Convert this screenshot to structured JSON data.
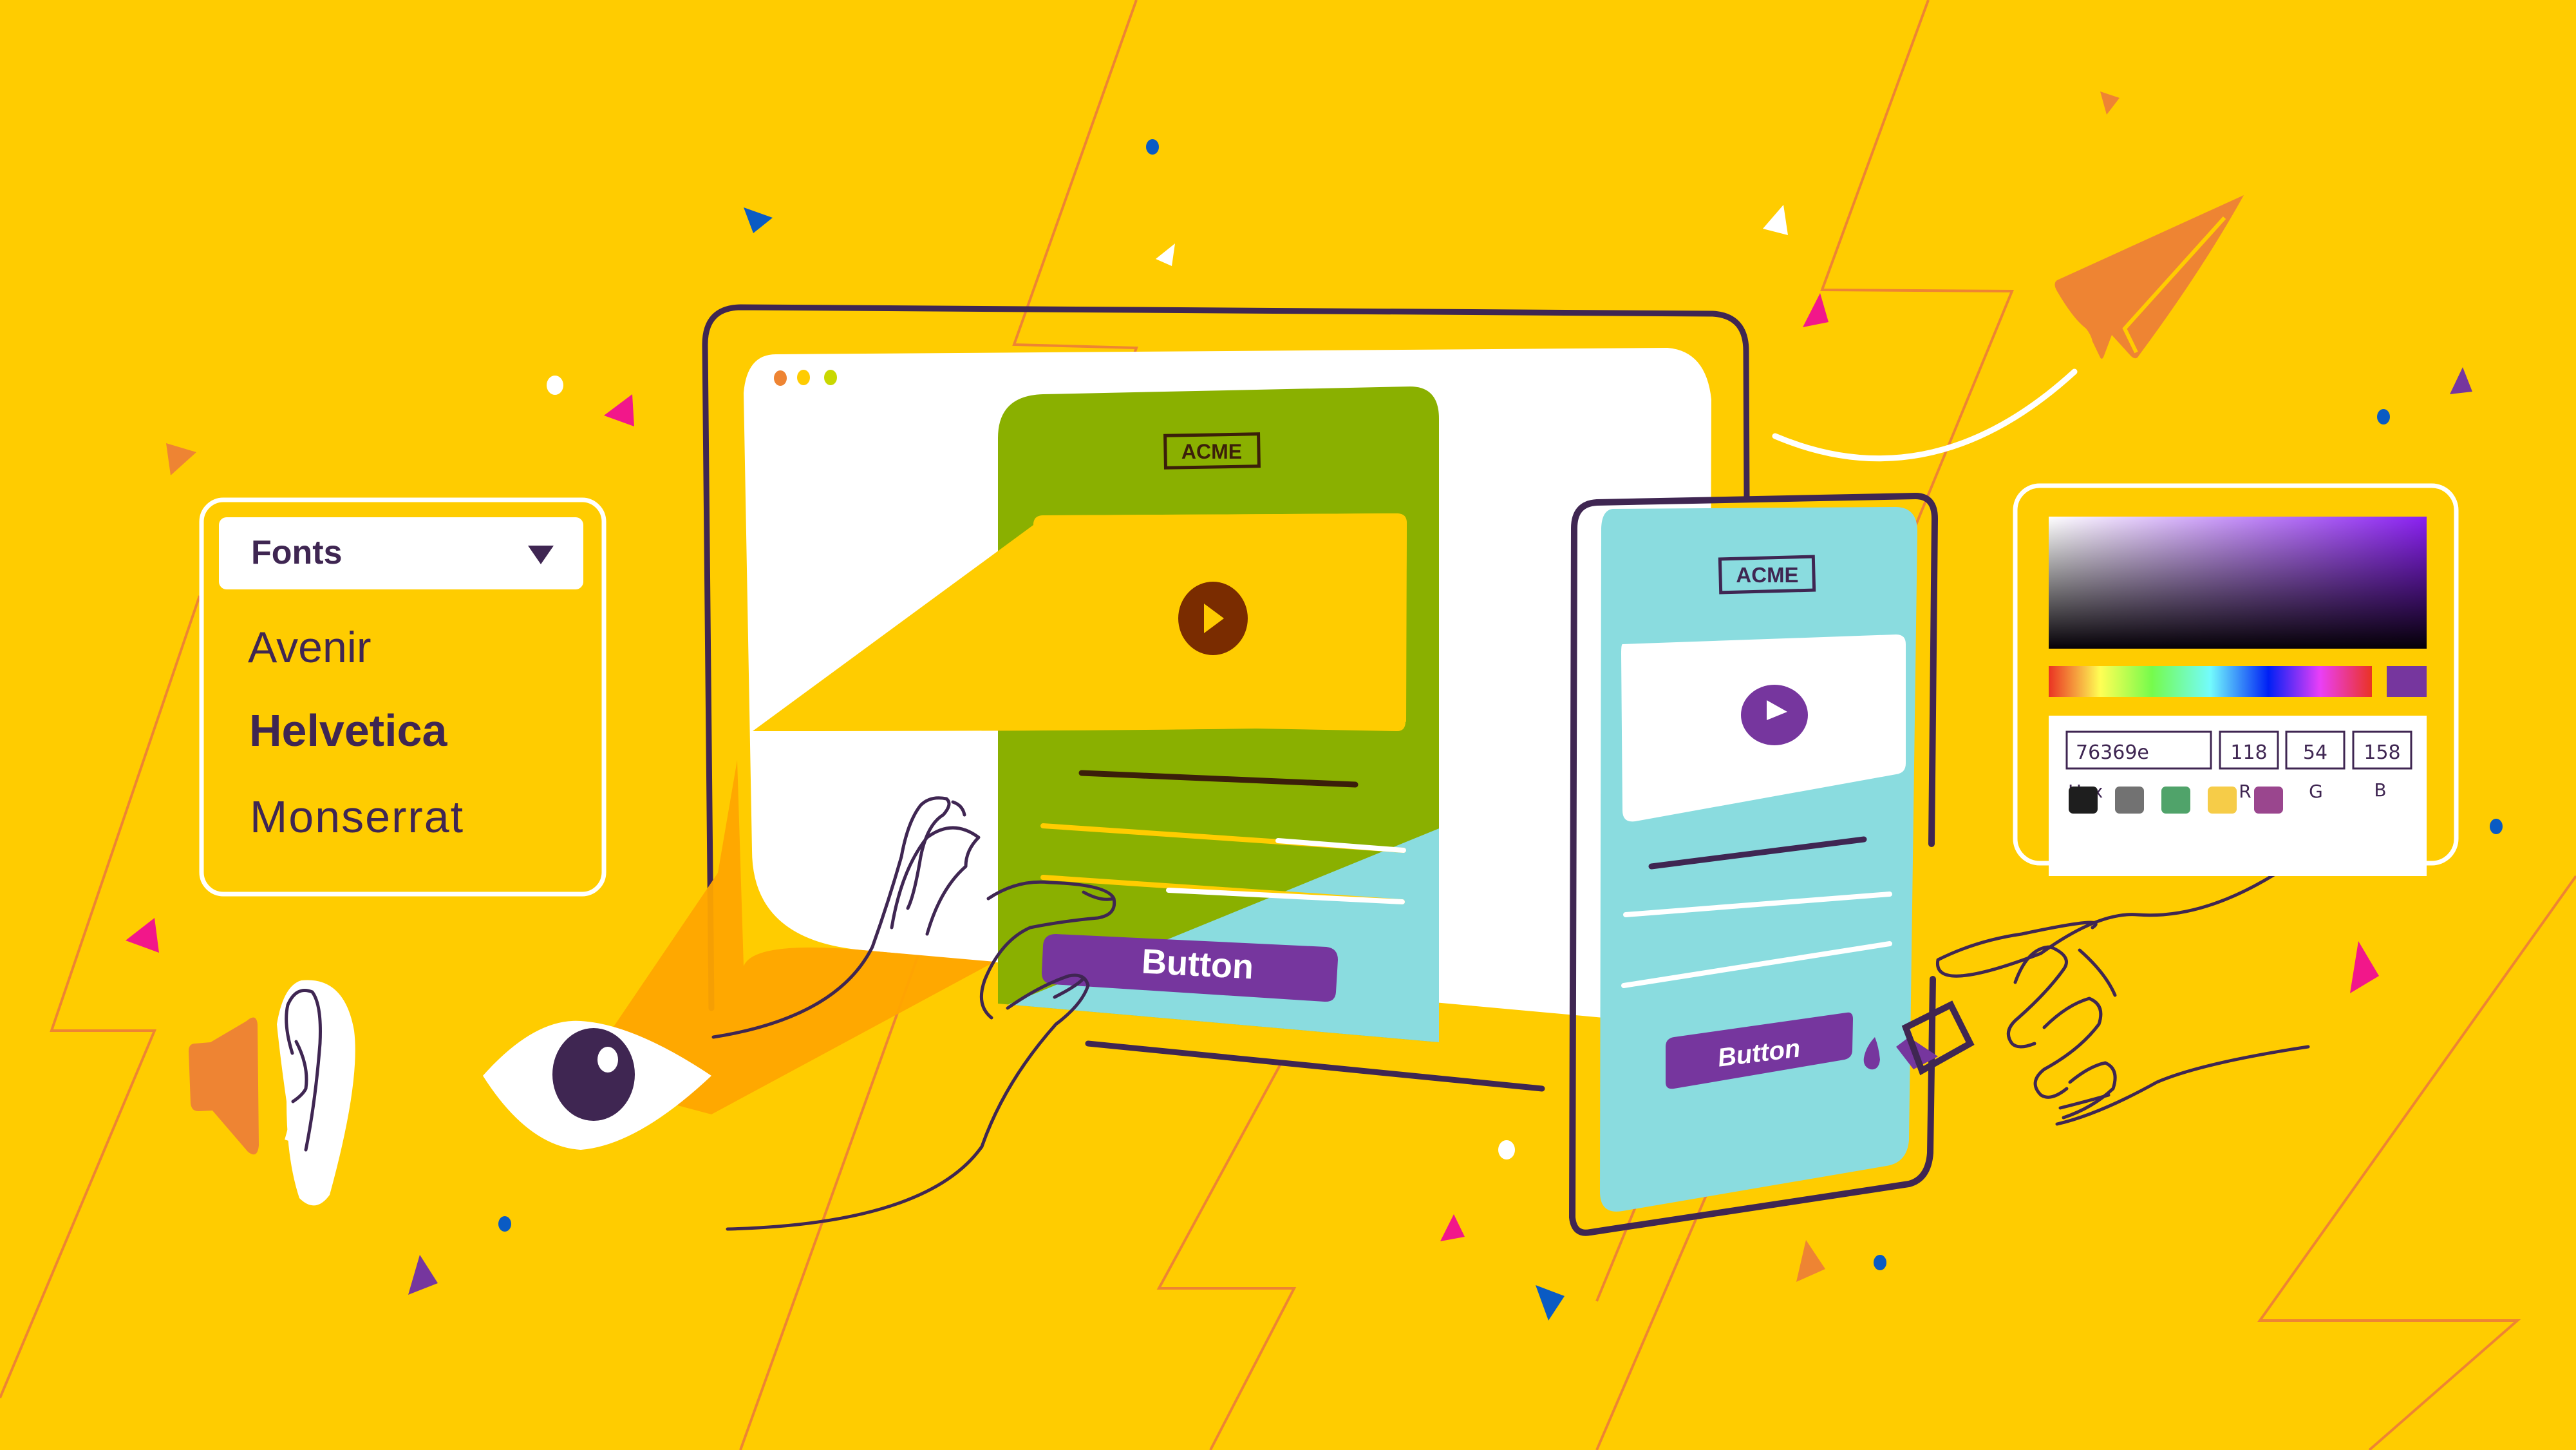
{
  "scene": {
    "background_color": "#FFCC00",
    "accent_purple": "#76369E",
    "outline_color": "#3F2652"
  },
  "fonts_panel": {
    "title": "Fonts",
    "dropdown_icon": "triangle-down",
    "options": [
      {
        "label": "Avenir"
      },
      {
        "label": "Helvetica"
      },
      {
        "label": "Monserrat"
      }
    ]
  },
  "desktop_browser": {
    "window_dots": [
      "#EE8433",
      "#FFCC00",
      "#C9D800"
    ],
    "page": {
      "logo": "ACME",
      "video_play_icon": "play-icon",
      "button_label": "Button",
      "card_color": "#8AB000",
      "video_color": "#FFCC00",
      "play_color": "#7A2C00"
    }
  },
  "tablet": {
    "page": {
      "logo": "ACME",
      "video_play_icon": "play-icon",
      "button_label": "Button",
      "card_color": "#8ADCDF",
      "play_color": "#76369E"
    }
  },
  "color_picker": {
    "hex_value": "76369e",
    "hex_label": "Hex",
    "r_value": "118",
    "g_value": "54",
    "b_value": "158",
    "r_label": "R",
    "g_label": "G",
    "b_label": "B",
    "selected_color": "#76369E",
    "swatches": [
      "#1E1E1E",
      "#727272",
      "#50A36A",
      "#F6CC48",
      "#9A468E"
    ]
  },
  "accessibility_icons": [
    "speaker-icon",
    "ear-icon",
    "eye-icon"
  ]
}
